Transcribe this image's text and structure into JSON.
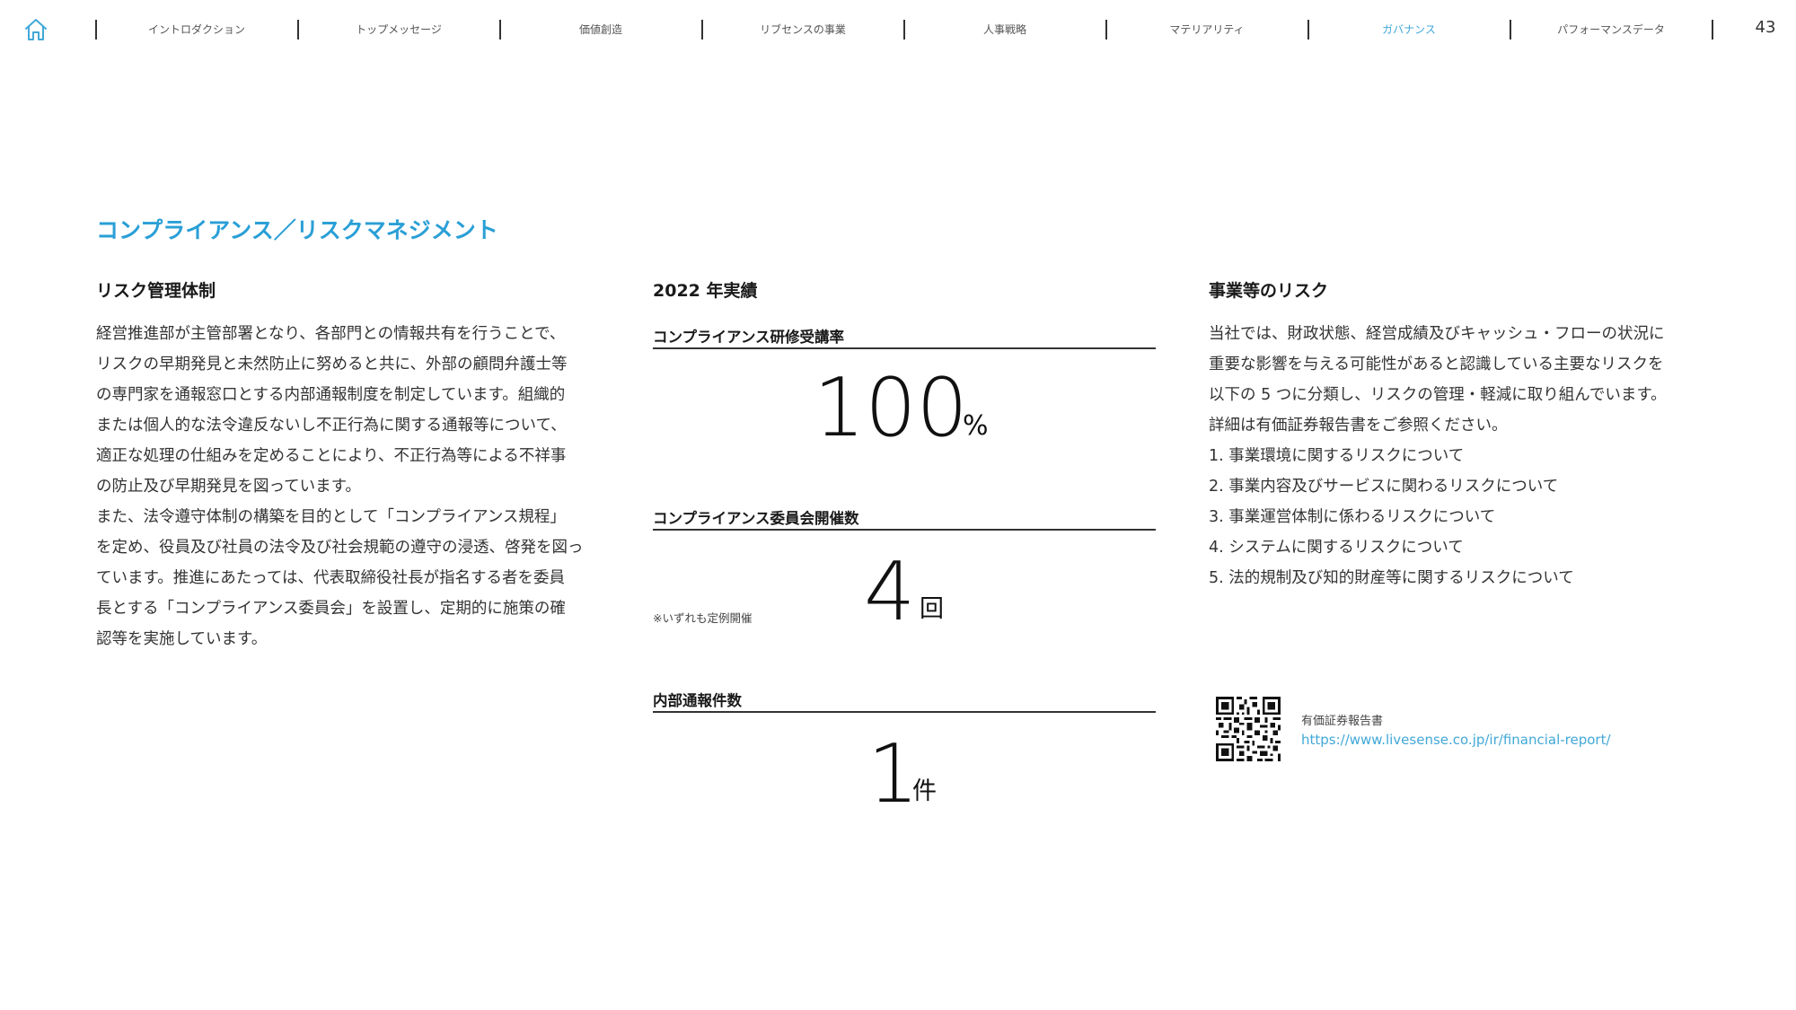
{
  "nav": {
    "home_icon": "home-icon",
    "items": [
      {
        "label": "イントロダクション",
        "active": false
      },
      {
        "label": "トップメッセージ",
        "active": false
      },
      {
        "label": "価値創造",
        "active": false
      },
      {
        "label": "リブセンスの事業",
        "active": false
      },
      {
        "label": "人事戦略",
        "active": false
      },
      {
        "label": "マテリアリティ",
        "active": false
      },
      {
        "label": "ガバナンス",
        "active": true
      },
      {
        "label": "パフォーマンスデータ",
        "active": false
      }
    ],
    "page_number": "43",
    "active_color": "#42a8d8"
  },
  "section_title": "コンプライアンス／リスクマネジメント",
  "left_column": {
    "heading": "リスク管理体制",
    "lines": [
      "経営推進部が主管部署となり、各部門との情報共有を行うことで、",
      "リスクの早期発見と未然防止に努めると共に、外部の顧問弁護士等",
      "の専門家を通報窓口とする内部通報制度を制定しています。組織的",
      "または個人的な法令違反ないし不正行為に関する通報等について、",
      "適正な処理の仕組みを定めることにより、不正行為等による不祥事",
      "の防止及び早期発見を図っています。",
      "また、法令遵守体制の構築を目的として「コンプライアンス規程」",
      "を定め、役員及び社員の法令及び社会規範の遵守の浸透、啓発を図っ",
      "ています。推進にあたっては、代表取締役社長が指名する者を委員",
      "長とする「コンプライアンス委員会」を設置し、定期的に施策の確",
      "認等を実施しています。"
    ]
  },
  "middle_column": {
    "heading": "2022 年実績",
    "kpis": [
      {
        "label": "コンプライアンス研修受講率",
        "value": "100",
        "unit": "%"
      },
      {
        "label": "コンプライアンス委員会開催数",
        "value": "4",
        "unit": "回",
        "note": "※いずれも定例開催"
      },
      {
        "label": "内部通報件数",
        "value": "1",
        "unit": "件"
      }
    ]
  },
  "right_column": {
    "heading": "事業等のリスク",
    "intro_lines": [
      "当社では、財政状態、経営成績及びキャッシュ・フローの状況に",
      "重要な影響を与える可能性があると認識している主要なリスクを",
      "以下の 5 つに分類し、リスクの管理・軽減に取り組んでいます。",
      "詳細は有価証券報告書をご参照ください。"
    ],
    "risks": [
      "1. 事業環境に関するリスクについて",
      "2. 事業内容及びサービスに関わるリスクについて",
      "3. 事業運営体制に係わるリスクについて",
      "4. システムに関するリスクについて",
      "5. 法的規制及び知的財産等に関するリスクについて"
    ],
    "qr_icon": "qr-code-icon",
    "report_label": "有価証券報告書",
    "report_url": "https://www.livesense.co.jp/ir/financial-report/"
  }
}
